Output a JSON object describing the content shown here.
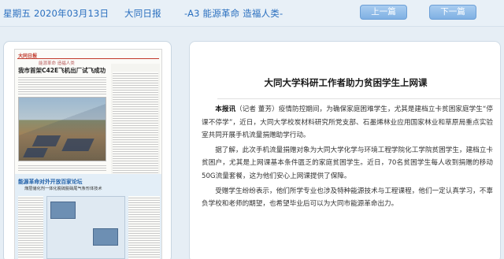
{
  "header": {
    "date": "星期五 2020年03月13日",
    "paper": "大同日报",
    "page": "-A3 能源革命 造福人类-",
    "prev_label": "上一篇",
    "next_label": "下一篇",
    "accent_color": "#2a6fbf"
  },
  "thumbnail": {
    "masthead": "大同日报",
    "section": "能源革命 造福人类",
    "headline": "我市首架C42E飞机出厂试飞成功",
    "feature_title": "能源革命对外开放百家论坛",
    "feature_subtitle": "煤层储化剂一体化脱硫脱硝尾气条形体技术"
  },
  "article": {
    "title": "大同大学科研工作者助力贫困学生上网课",
    "lead": "本报讯",
    "paragraphs": [
      "（记者 董芳）疫情防控期间，为确保家庭困难学生，尤其是建档立卡贫困家庭学生“停课不停学”，近日，大同大学校炭材料研究所党支部、石墨烯林业应用国家林业和草原局重点实验室共同开展手机流量捐赠助学行动。",
      "据了解，此次手机流量捐赠对象为大同大学化学与环境工程学院化工学院贫困学生，建档立卡贫困户，尤其是上网课基本条件匮乏的家庭贫困学生。近日，70名贫困学生每人收到捐赠的移动50G流量套餐，这为他们安心上网课提供了保障。",
      "受赠学生纷纷表示，他们所学专业也涉及特种能源技术与工程课程，他们一定认真学习，不辜负学校和老师的期望，也希望毕业后可以为大同市能源革命出力。"
    ]
  }
}
